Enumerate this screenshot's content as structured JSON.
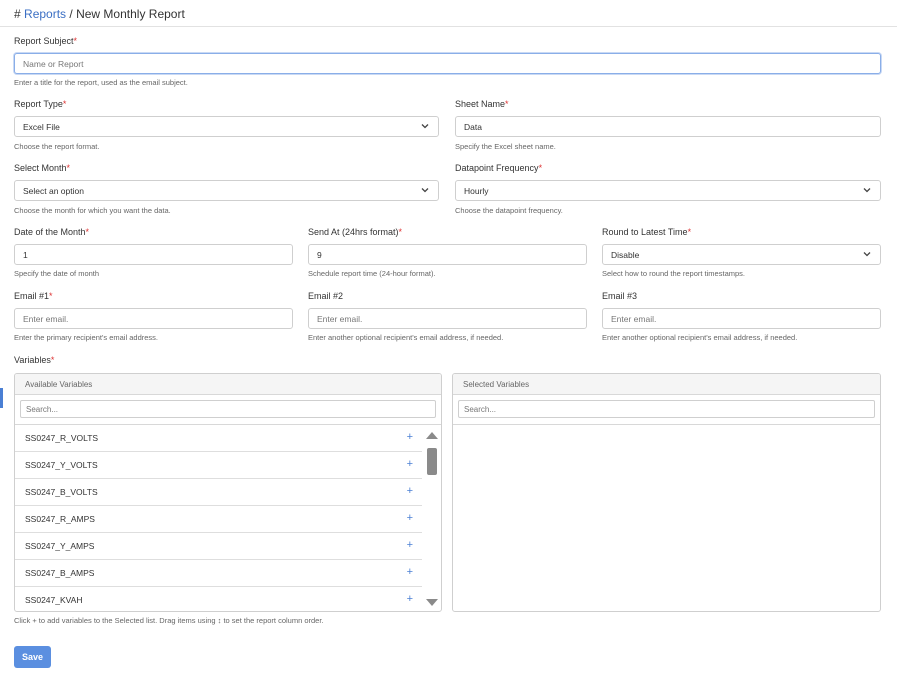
{
  "breadcrumb": {
    "hash": "#",
    "link": "Reports",
    "separator": "/",
    "current": "New Monthly Report"
  },
  "form": {
    "report_subject": {
      "label": "Report Subject",
      "placeholder": "Name or Report",
      "help": "Enter a title for the report, used as the email subject."
    },
    "report_type": {
      "label": "Report Type",
      "value": "Excel File",
      "help": "Choose the report format."
    },
    "sheet_name": {
      "label": "Sheet Name",
      "value": "Data",
      "help": "Specify the Excel sheet name."
    },
    "select_month": {
      "label": "Select Month",
      "value": "Select an option",
      "help": "Choose the month for which you want the data."
    },
    "datapoint_frequency": {
      "label": "Datapoint Frequency",
      "value": "Hourly",
      "help": "Choose the datapoint frequency."
    },
    "date_of_month": {
      "label": "Date of the Month",
      "value": "1",
      "help": "Specify the date of month"
    },
    "send_at": {
      "label": "Send At (24hrs format)",
      "value": "9",
      "help": "Schedule report time (24-hour format)."
    },
    "round_latest": {
      "label": "Round to Latest Time",
      "value": "Disable",
      "help": "Select how to round the report timestamps."
    },
    "email1": {
      "label": "Email #1",
      "placeholder": "Enter email.",
      "help": "Enter the primary recipient's email address."
    },
    "email2": {
      "label": "Email #2",
      "placeholder": "Enter email.",
      "help": "Enter another optional recipient's email address, if needed."
    },
    "email3": {
      "label": "Email #3",
      "placeholder": "Enter email.",
      "help": "Enter another optional recipient's email address, if needed."
    },
    "required_marker": "*"
  },
  "variables": {
    "label": "Variables",
    "available_title": "Available Variables",
    "selected_title": "Selected Variables",
    "search_placeholder": "Search...",
    "available_items": [
      "SS0247_R_VOLTS",
      "SS0247_Y_VOLTS",
      "SS0247_B_VOLTS",
      "SS0247_R_AMPS",
      "SS0247_Y_AMPS",
      "SS0247_B_AMPS",
      "SS0247_KVAH"
    ],
    "add_symbol": "+",
    "help": "Click + to add variables to the Selected list. Drag items using ↕ to set the report column order."
  },
  "actions": {
    "save_label": "Save"
  },
  "icons": {
    "dropdown": "chevron-down-icon",
    "add": "plus-icon",
    "scroll_up": "triangle-up-icon",
    "scroll_down": "triangle-down-icon"
  },
  "colors": {
    "accent": "#5b8fe0",
    "link": "#3b6fc4",
    "required": "#dd3333",
    "add_icon": "#4a7fd4"
  }
}
